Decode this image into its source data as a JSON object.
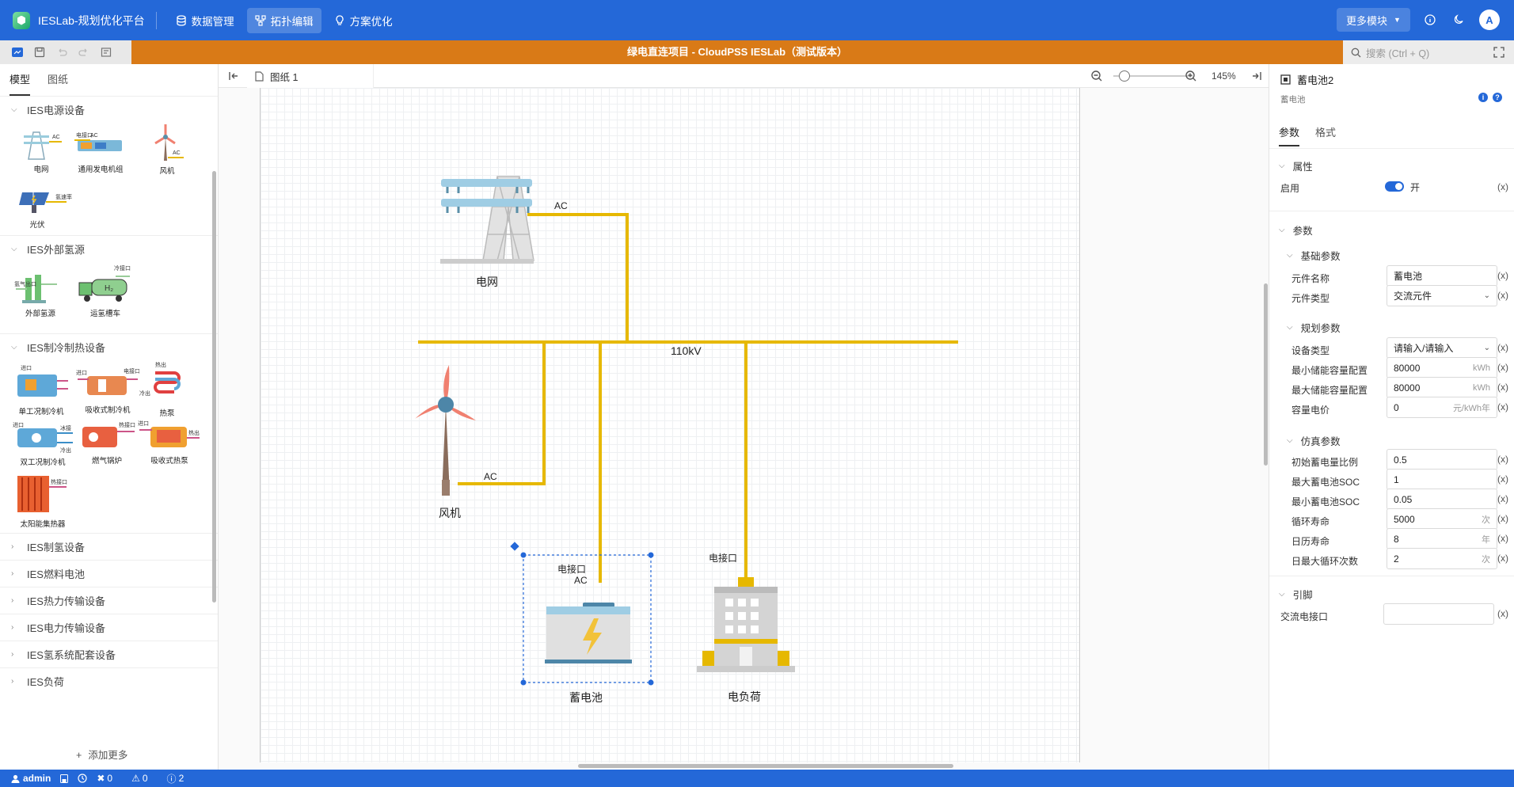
{
  "topbar": {
    "app_title": "IESLab-规划优化平台",
    "nav": [
      {
        "label": "数据管理",
        "icon": "database-icon"
      },
      {
        "label": "拓扑编辑",
        "icon": "topology-icon"
      },
      {
        "label": "方案优化",
        "icon": "bulb-icon"
      }
    ],
    "more_label": "更多模块",
    "avatar_letter": "A"
  },
  "toolbar": {
    "document_title": "绿电直连项目 - CloudPSS IESLab（测试版本）",
    "search_placeholder": "搜索 (Ctrl + Q)"
  },
  "left_panel": {
    "tabs": [
      "模型",
      "图纸"
    ],
    "categories": [
      {
        "label": "IES电源设备",
        "expanded": true,
        "items": [
          "电网",
          "通用发电机组",
          "风机",
          "光伏"
        ]
      },
      {
        "label": "IES外部氢源",
        "expanded": true,
        "items": [
          "外部氢源",
          "运氢槽车"
        ]
      },
      {
        "label": "IES制冷制热设备",
        "expanded": true,
        "items": [
          "单工况制冷机",
          "吸收式制冷机",
          "热泵",
          "双工况制冷机",
          "燃气锅炉",
          "吸收式热泵",
          "太阳能集热器"
        ]
      },
      {
        "label": "IES制氢设备",
        "expanded": false
      },
      {
        "label": "IES燃料电池",
        "expanded": false
      },
      {
        "label": "IES热力传输设备",
        "expanded": false
      },
      {
        "label": "IES电力传输设备",
        "expanded": false
      },
      {
        "label": "IES氢系统配套设备",
        "expanded": false
      },
      {
        "label": "IES负荷",
        "expanded": false
      }
    ],
    "add_more": "添加更多",
    "port_labels": [
      "AC",
      "电接口",
      "AC",
      "AC",
      "氢速率",
      "氢气出口",
      "冷接口",
      "进口",
      "进口",
      "冷出",
      "电接口",
      "热出",
      "进口",
      "冰接",
      "冷出",
      "热接口",
      "进口",
      "热出",
      "热接口",
      "出口"
    ]
  },
  "canvas_header": {
    "sheet_name": "图纸 1",
    "zoom": "145%"
  },
  "diagram": {
    "bus_label": "110kV",
    "grid_label": "电网",
    "grid_port": "AC",
    "wind_label": "风机",
    "wind_port": "AC",
    "battery_label": "蓄电池",
    "battery_port_name": "电接口",
    "battery_port_type": "AC",
    "load_label": "电负荷",
    "load_port_name": "电接口",
    "colors": {
      "line": "#e6b800",
      "selection": "#2468d8"
    }
  },
  "right_panel": {
    "title": "蓄电池2",
    "subtitle": "蓄电池",
    "tabs": [
      "参数",
      "格式"
    ],
    "sections": {
      "attributes": "属性",
      "params": "参数",
      "basic": "基础参数",
      "planning": "规划参数",
      "sim": "仿真参数",
      "pins": "引脚"
    },
    "enable": {
      "label": "启用",
      "value": "开"
    },
    "basic_params": [
      {
        "label": "元件名称",
        "value": "蓄电池",
        "unit": ""
      },
      {
        "label": "元件类型",
        "value": "交流元件",
        "unit": "",
        "dropdown": true
      }
    ],
    "planning_params": [
      {
        "label": "设备类型",
        "value": "请输入/请输入",
        "unit": "",
        "dropdown": true
      },
      {
        "label": "最小储能容量配置",
        "value": "80000",
        "unit": "kWh"
      },
      {
        "label": "最大储能容量配置",
        "value": "80000",
        "unit": "kWh"
      },
      {
        "label": "容量电价",
        "value": "0",
        "unit": "元/kWh年"
      }
    ],
    "sim_params": [
      {
        "label": "初始蓄电量比例",
        "value": "0.5",
        "unit": ""
      },
      {
        "label": "最大蓄电池SOC",
        "value": "1",
        "unit": ""
      },
      {
        "label": "最小蓄电池SOC",
        "value": "0.05",
        "unit": ""
      },
      {
        "label": "循环寿命",
        "value": "5000",
        "unit": "次"
      },
      {
        "label": "日历寿命",
        "value": "8",
        "unit": "年"
      },
      {
        "label": "日最大循环次数",
        "value": "2",
        "unit": "次"
      }
    ],
    "pin_params": [
      {
        "label": "交流电接口",
        "value": "",
        "unit": ""
      }
    ],
    "x_label": "(x)"
  },
  "statusbar": {
    "user": "admin",
    "errors": "0",
    "warnings": "0",
    "infos": "2"
  }
}
